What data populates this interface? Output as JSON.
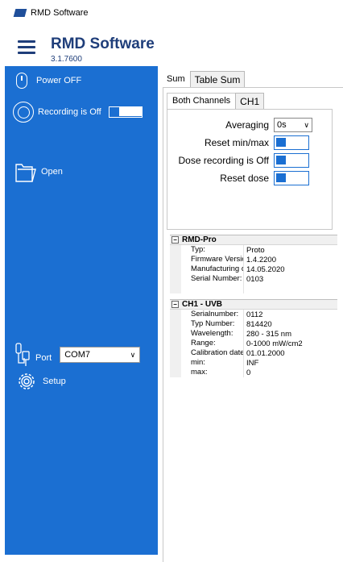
{
  "window": {
    "title": "RMD Software"
  },
  "header": {
    "app_name": "RMD Software",
    "version": "3.1.7600"
  },
  "sidebar": {
    "power_label": "Power OFF",
    "recording_label": "Recording is Off",
    "open_label": "Open",
    "port_label": "Port",
    "port_value": "COM7",
    "setup_label": "Setup"
  },
  "tabs_top": [
    {
      "label": "Sum",
      "active": true
    },
    {
      "label": "Table Sum",
      "active": false
    }
  ],
  "tabs_channel": [
    {
      "label": "Both Channels",
      "active": true
    },
    {
      "label": "CH1",
      "active": false
    }
  ],
  "controls": {
    "averaging_label": "Averaging",
    "averaging_value": "0s",
    "reset_minmax_label": "Reset min/max",
    "dose_recording_label": "Dose recording is Off",
    "reset_dose_label": "Reset dose"
  },
  "device_section": {
    "title": "RMD-Pro",
    "rows": [
      {
        "key": "Typ:",
        "value": "Proto"
      },
      {
        "key": "Firmware Version",
        "value": "1.4.2200"
      },
      {
        "key": "Manufacturing d",
        "value": "14.05.2020"
      },
      {
        "key": "Serial Number:",
        "value": "0103"
      }
    ]
  },
  "channel_section": {
    "title": "CH1 - UVB",
    "rows": [
      {
        "key": "Serialnumber:",
        "value": "0112"
      },
      {
        "key": "Typ Number:",
        "value": "814420"
      },
      {
        "key": "Wavelength:",
        "value": "280 - 315 nm"
      },
      {
        "key": "Range:",
        "value": "0-1000 mW/cm2"
      },
      {
        "key": "Calibration date",
        "value": "01.01.2000"
      },
      {
        "key": "min:",
        "value": "INF"
      },
      {
        "key": "max:",
        "value": "0"
      }
    ]
  },
  "colors": {
    "sidebar_bg": "#1b6fd2",
    "header_text": "#1f3e7a",
    "switch_accent": "#1b6fd2"
  }
}
